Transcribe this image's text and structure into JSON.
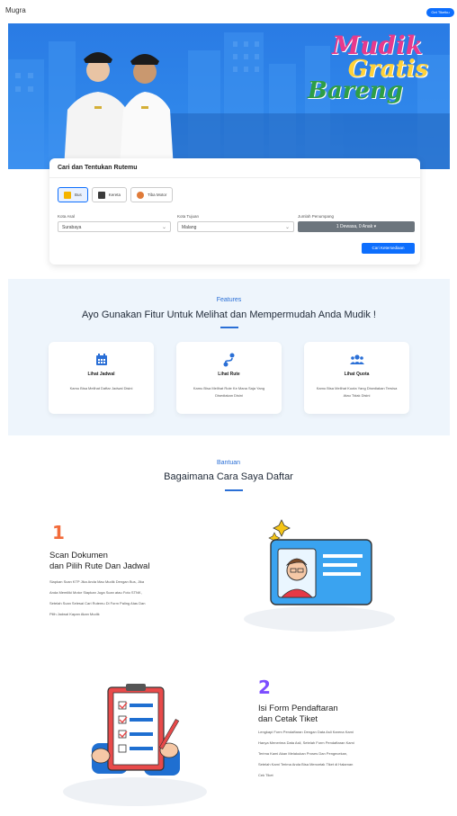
{
  "nav": {
    "brand": "Mugra",
    "login_label": "Get Tiketku"
  },
  "hero": {
    "title_line1": "Mudik",
    "title_line2": "Gratis",
    "title_line3": "Bareng"
  },
  "search": {
    "card_title": "Cari dan Tentukan Rutemu",
    "modes": [
      {
        "label": "Bus",
        "icon": "bus-icon",
        "active": true
      },
      {
        "label": "Kereta",
        "icon": "train-icon",
        "active": false
      },
      {
        "label": "Tiba Motor",
        "icon": "motorcycle-icon",
        "active": false
      }
    ],
    "origin_label": "Kota Asal",
    "origin_value": "Surabaya",
    "destination_label": "Kota Tujuan",
    "destination_value": "Malang",
    "passengers_label": "Jumlah Penumpang",
    "passengers_value": "1 Dewasa, 0 Anak",
    "search_button": "Cari Ketersediaan"
  },
  "features": {
    "eyebrow": "Features",
    "title": "Ayo Gunakan Fitur Untuk Melihat dan Mempermudah Anda Mudik !",
    "items": [
      {
        "icon": "calendar-icon",
        "name": "Lihat Jadwal",
        "desc": "Kamu Bisa Melihat Daftar Jadwal Disini"
      },
      {
        "icon": "route-icon",
        "name": "Lihat Rute",
        "desc": "Kamu Bisa Melihat Rute Ke Mana Saja Yang Disediakan Disini"
      },
      {
        "icon": "users-icon",
        "name": "Lihat Quota",
        "desc": "Kamu Bisa Melihat Kuota Yang Disediakan Tersisa Atau Tidak Disini"
      }
    ]
  },
  "help": {
    "eyebrow": "Bantuan",
    "title": "Bagaimana Cara Saya Daftar",
    "steps": [
      {
        "number": "1",
        "title": "Scan Dokumen\ndan Pilih Rute Dan Jadwal",
        "desc_lines": [
          "Siapkan Scan KTP Jika Anda Mau Mudik Dengan Bus, Jika",
          "Anda Memiliki Motor Siapkan Juga Scan atau Foto STNK,",
          "Setelah Scan Selesai Cari Rutemu Di Form Paling Atas Dan",
          "Pilih Jadwal Kapan Akan Mudik"
        ]
      },
      {
        "number": "2",
        "title": "Isi Form Pendaftaran\ndan Cetak Tiket",
        "desc_lines": [
          "Lengkapi Form Pendaftaran Dengan Data Asli Karena Kami",
          "Hanya Menerima Data Asli, Setelah Form Pendaftaran Kami",
          "Terima Kami Akan Melakukan Proses Dan Pengecekan,",
          "Setelah Kami Terima Anda Bisa Mencetak Tiket di Halaman",
          "Cek Tiket"
        ]
      }
    ]
  },
  "colors": {
    "primary": "#0d6efd",
    "step1": "#f26b3a",
    "step2": "#7c4dff"
  }
}
